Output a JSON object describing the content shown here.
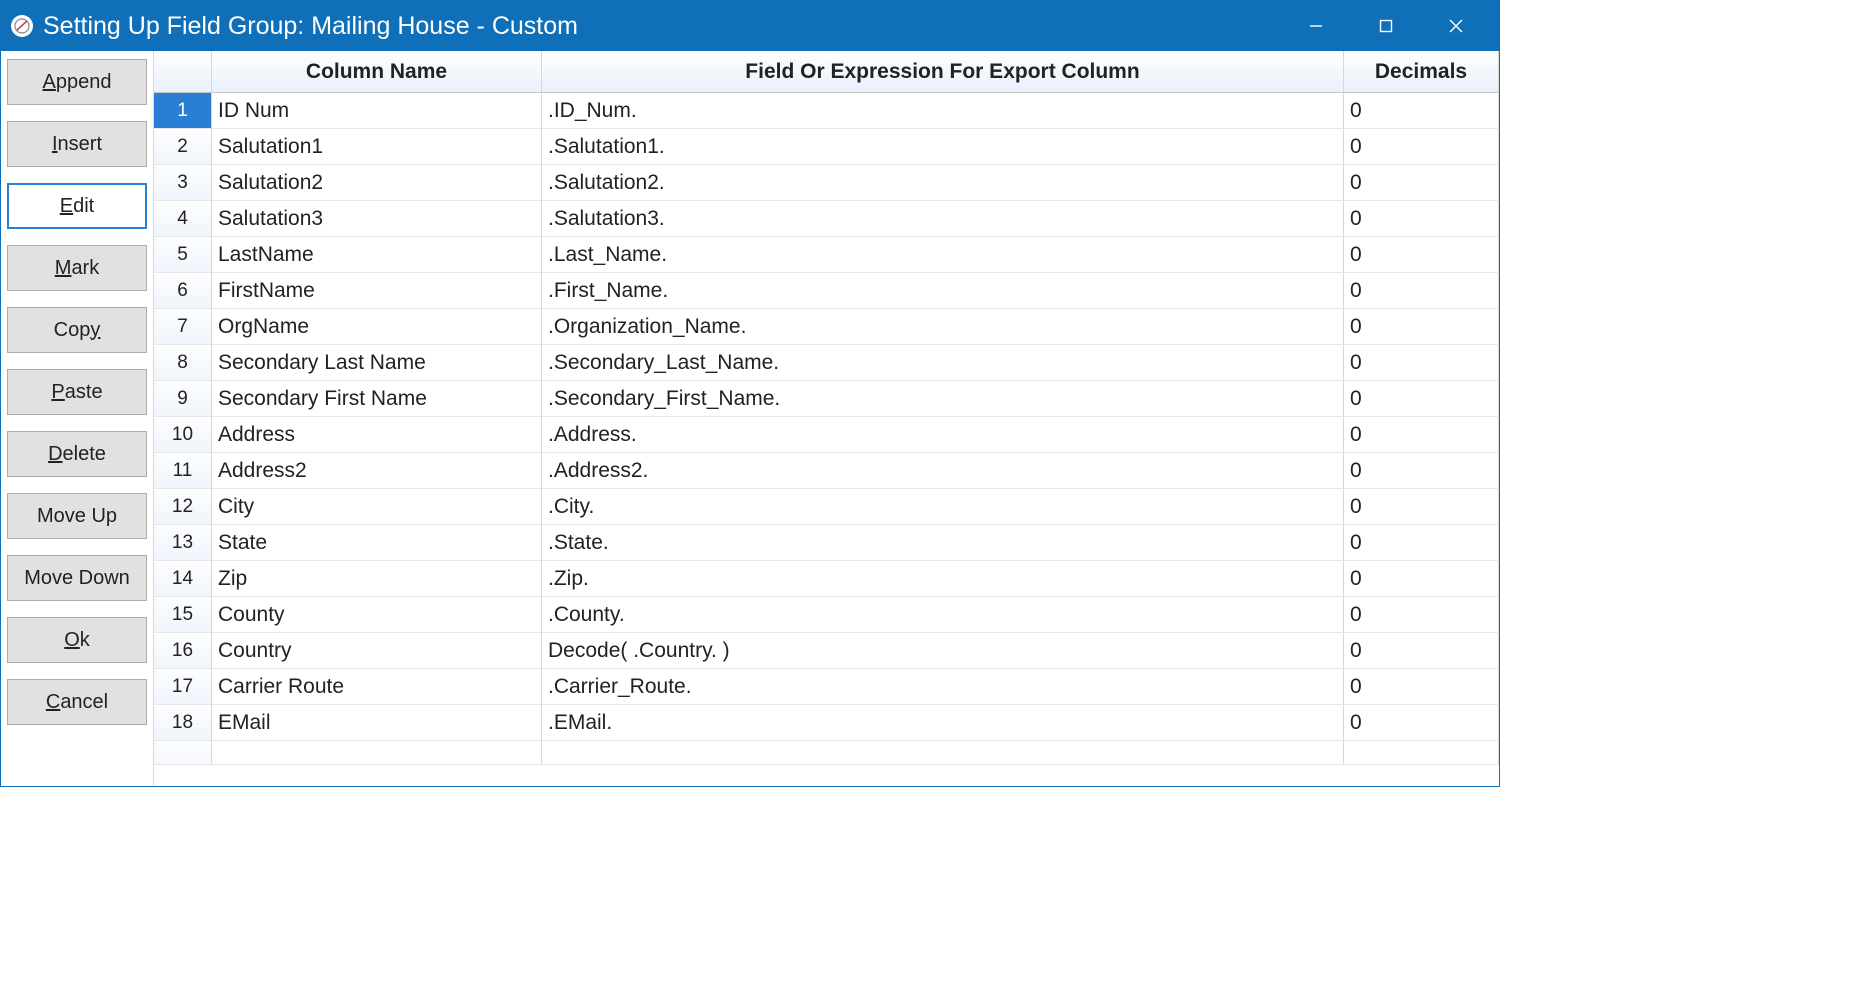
{
  "window": {
    "title": "Setting Up Field Group: Mailing House - Custom"
  },
  "sidebar": {
    "buttons": [
      {
        "label": "Append",
        "accel_index": 0,
        "active": false,
        "name": "append-button"
      },
      {
        "label": "Insert",
        "accel_index": 0,
        "active": false,
        "name": "insert-button"
      },
      {
        "label": "Edit",
        "accel_index": 0,
        "active": true,
        "name": "edit-button"
      },
      {
        "label": "Mark",
        "accel_index": 0,
        "active": false,
        "name": "mark-button"
      },
      {
        "label": "Copy",
        "accel_index": 3,
        "active": false,
        "name": "copy-button"
      },
      {
        "label": "Paste",
        "accel_index": 0,
        "active": false,
        "name": "paste-button"
      },
      {
        "label": "Delete",
        "accel_index": 0,
        "active": false,
        "name": "delete-button"
      },
      {
        "label": "Move Up",
        "accel_index": -1,
        "active": false,
        "name": "move-up-button"
      },
      {
        "label": "Move Down",
        "accel_index": -1,
        "active": false,
        "name": "move-down-button"
      },
      {
        "label": "Ok",
        "accel_index": 0,
        "active": false,
        "name": "ok-button"
      },
      {
        "label": "Cancel",
        "accel_index": 0,
        "active": false,
        "name": "cancel-button"
      }
    ]
  },
  "grid": {
    "headers": {
      "num": "",
      "name": "Column Name",
      "expr": "Field Or Expression For Export Column",
      "dec": "Decimals"
    },
    "selected_row": 1,
    "rows": [
      {
        "n": "1",
        "name": "ID Num",
        "expr": ".ID_Num.",
        "dec": "0"
      },
      {
        "n": "2",
        "name": "Salutation1",
        "expr": ".Salutation1.",
        "dec": "0"
      },
      {
        "n": "3",
        "name": "Salutation2",
        "expr": ".Salutation2.",
        "dec": "0"
      },
      {
        "n": "4",
        "name": "Salutation3",
        "expr": ".Salutation3.",
        "dec": "0"
      },
      {
        "n": "5",
        "name": "LastName",
        "expr": ".Last_Name.",
        "dec": "0"
      },
      {
        "n": "6",
        "name": "FirstName",
        "expr": ".First_Name.",
        "dec": "0"
      },
      {
        "n": "7",
        "name": "OrgName",
        "expr": ".Organization_Name.",
        "dec": "0"
      },
      {
        "n": "8",
        "name": "Secondary Last Name",
        "expr": ".Secondary_Last_Name.",
        "dec": "0"
      },
      {
        "n": "9",
        "name": "Secondary First Name",
        "expr": ".Secondary_First_Name.",
        "dec": "0"
      },
      {
        "n": "10",
        "name": "Address",
        "expr": ".Address.",
        "dec": "0"
      },
      {
        "n": "11",
        "name": "Address2",
        "expr": ".Address2.",
        "dec": "0"
      },
      {
        "n": "12",
        "name": "City",
        "expr": ".City.",
        "dec": "0"
      },
      {
        "n": "13",
        "name": "State",
        "expr": ".State.",
        "dec": "0"
      },
      {
        "n": "14",
        "name": "Zip",
        "expr": ".Zip.",
        "dec": "0"
      },
      {
        "n": "15",
        "name": "County",
        "expr": ".County.",
        "dec": "0"
      },
      {
        "n": "16",
        "name": "Country",
        "expr": "Decode( .Country. )",
        "dec": "0"
      },
      {
        "n": "17",
        "name": "Carrier Route",
        "expr": ".Carrier_Route.",
        "dec": "0"
      },
      {
        "n": "18",
        "name": "EMail",
        "expr": ".EMail.",
        "dec": "0"
      }
    ]
  }
}
